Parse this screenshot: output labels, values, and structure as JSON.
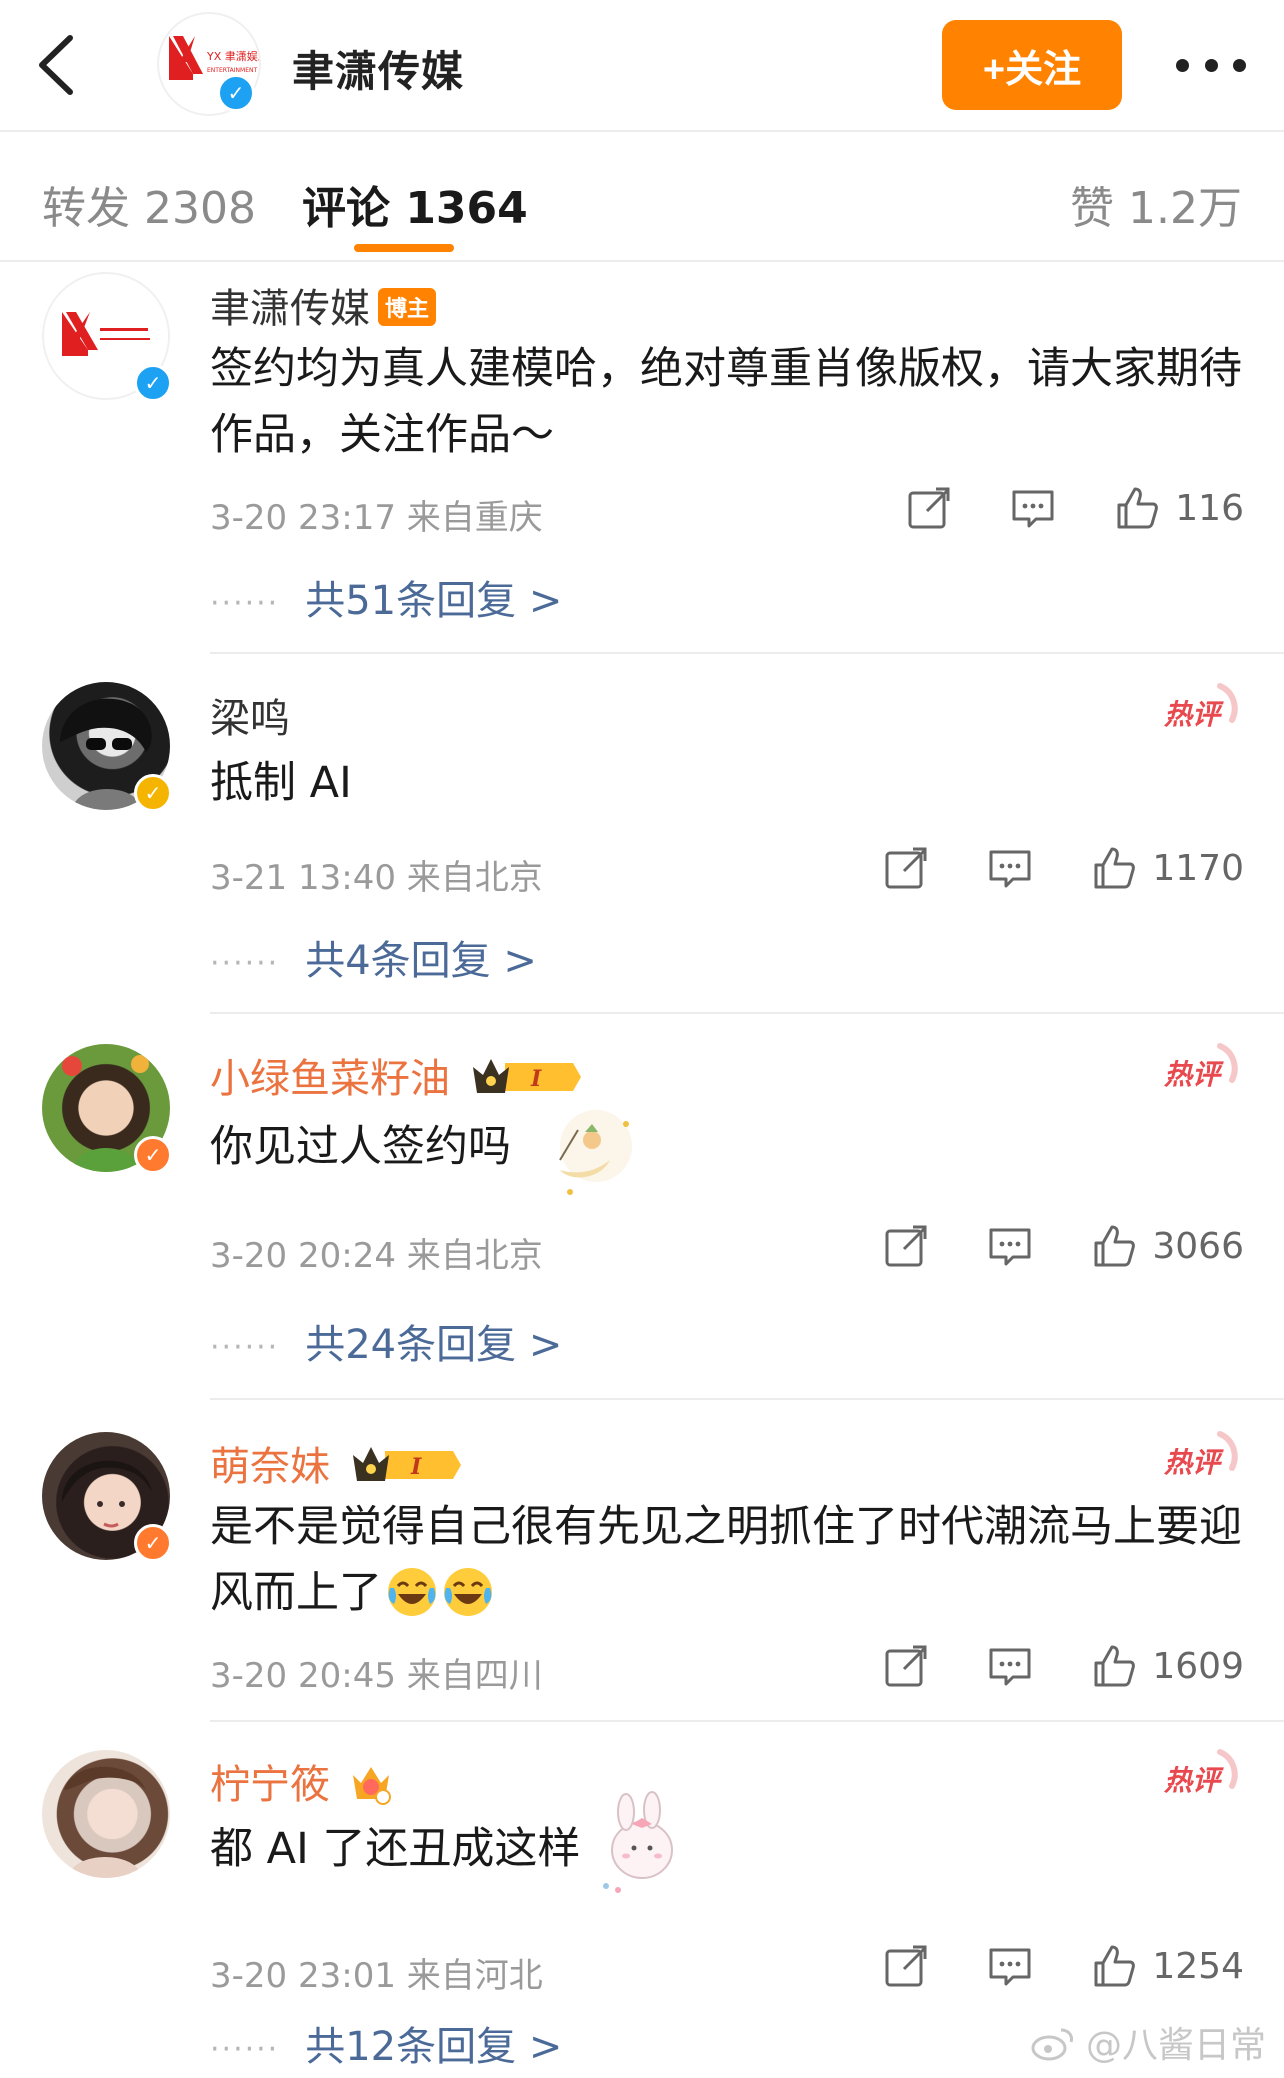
{
  "header": {
    "account_name": "聿潇传媒",
    "logo_text": "YX 聿潇娱乐",
    "logo_sub": "ENTERTAINMENT",
    "follow_label": "+关注"
  },
  "tabs": {
    "repost": "转发 2308",
    "comments": "评论 1364",
    "likes": "赞 1.2万"
  },
  "comments": [
    {
      "name": "聿潇传媒",
      "badge": "博主",
      "text": "签约均为真人建模哈，绝对尊重肖像版权，请大家期待作品，关注作品～",
      "meta": "3-20 23:17 来自重庆",
      "likes": "116",
      "replies": "共51条回复 >",
      "verified_color": "#1da1f2"
    },
    {
      "name": "梁鸣",
      "text": "抵制 AI",
      "meta": "3-21 13:40 来自北京",
      "likes": "1170",
      "replies": "共4条回复 >",
      "hot_label": "热评",
      "verified_color": "#f5b400"
    },
    {
      "name": "小绿鱼菜籽油",
      "text": "你见过人签约吗",
      "meta": "3-20 20:24 来自北京",
      "likes": "3066",
      "replies": "共24条回复 >",
      "hot_label": "热评",
      "vip_level": "I",
      "verified_color": "#ff7a2e"
    },
    {
      "name": "萌奈妹",
      "text": "是不是觉得自己很有先见之明抓住了时代潮流马上要迎风而上了",
      "emoji": [
        "laugh-cry-emoji",
        "laugh-cry-emoji"
      ],
      "meta": "3-20 20:45 来自四川",
      "likes": "1609",
      "hot_label": "热评",
      "vip_level": "I",
      "verified_color": "#ff7a2e"
    },
    {
      "name": "柠宁筱",
      "text": "都 AI 了还丑成这样",
      "meta": "3-20 23:01 来自河北",
      "likes": "1254",
      "replies": "共12条回复 >",
      "hot_label": "热评"
    }
  ],
  "watermark": "@八酱日常",
  "colors": {
    "accent": "#ff8200",
    "link": "#4b6a98",
    "vip_name": "#eb7340",
    "hot": "#e8494f"
  }
}
